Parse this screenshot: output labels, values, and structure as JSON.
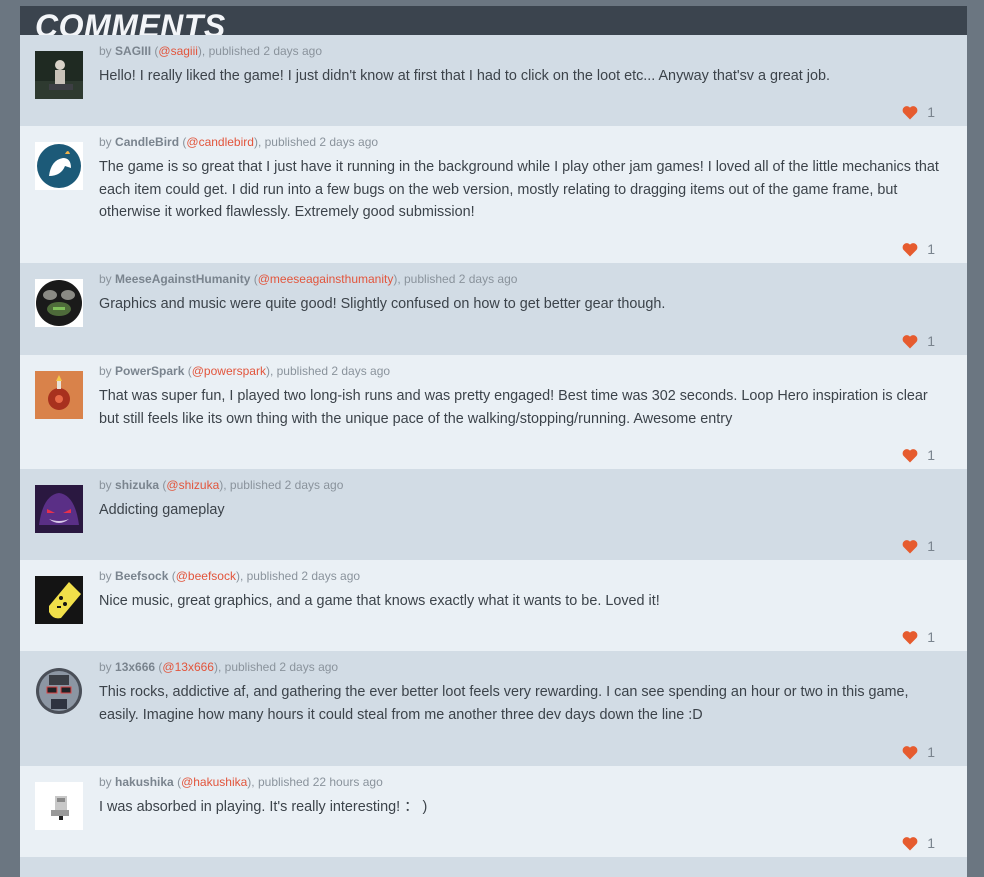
{
  "section": {
    "title": "COMMENTS"
  },
  "colors": {
    "accent": "#e2553c",
    "heart": "#e65b2e",
    "row_odd": "#d2dce5",
    "row_even": "#eaf0f5"
  },
  "comments": [
    {
      "user": "SAGIII",
      "handle": "@sagiii",
      "published": "2 days ago",
      "body": "Hello! I really liked the game! I just didn't know at first that I had to click on the loot etc... Anyway that'sv a great job.",
      "likes": "1",
      "avatar": "photo-avatar"
    },
    {
      "user": "CandleBird",
      "handle": "@candlebird",
      "published": "2 days ago",
      "body": "The game is so great that I just have it running in the background while I play other jam games! I loved all of the little mechanics that each item could get. I did run into a few bugs on the web version, mostly relating to dragging items out of the game frame, but otherwise it worked flawlessly. Extremely good submission!",
      "likes": "1",
      "avatar": "bird-avatar"
    },
    {
      "user": "MeeseAgainstHumanity",
      "handle": "@meeseagainsthumanity",
      "published": "2 days ago",
      "body": "Graphics and music were quite good! Slightly confused on how to get better gear though.",
      "likes": "1",
      "avatar": "moose-avatar"
    },
    {
      "user": "PowerSpark",
      "handle": "@powerspark",
      "published": "2 days ago",
      "body": "That was super fun, I played two long-ish runs and was pretty engaged! Best time was 302 seconds. Loop Hero inspiration is clear but still feels like its own thing with the unique pace of the walking/stopping/running. Awesome entry",
      "likes": "1",
      "avatar": "spark-avatar"
    },
    {
      "user": "shizuka",
      "handle": "@shizuka",
      "published": "2 days ago",
      "body": "Addicting gameplay",
      "likes": "1",
      "avatar": "ghost-avatar"
    },
    {
      "user": "Beefsock",
      "handle": "@beefsock",
      "published": "2 days ago",
      "body": "Nice music, great graphics, and a game that knows exactly what it wants to be. Loved it!",
      "likes": "1",
      "avatar": "sock-avatar"
    },
    {
      "user": "13x666",
      "handle": "@13x666",
      "published": "2 days ago",
      "body": "This rocks, addictive af, and gathering the ever better loot feels very rewarding. I can see spending an hour or two in this game, easily. Imagine how many hours it could steal from me another three dev days down the line :D",
      "likes": "1",
      "avatar": "glasses-avatar"
    },
    {
      "user": "hakushika",
      "handle": "@hakushika",
      "published": "22 hours ago",
      "body": "I was absorbed in playing. It's really interesting! ： )",
      "likes": "1",
      "avatar": "pixel-avatar"
    }
  ],
  "labels": {
    "by": "by",
    "published": ", published"
  }
}
